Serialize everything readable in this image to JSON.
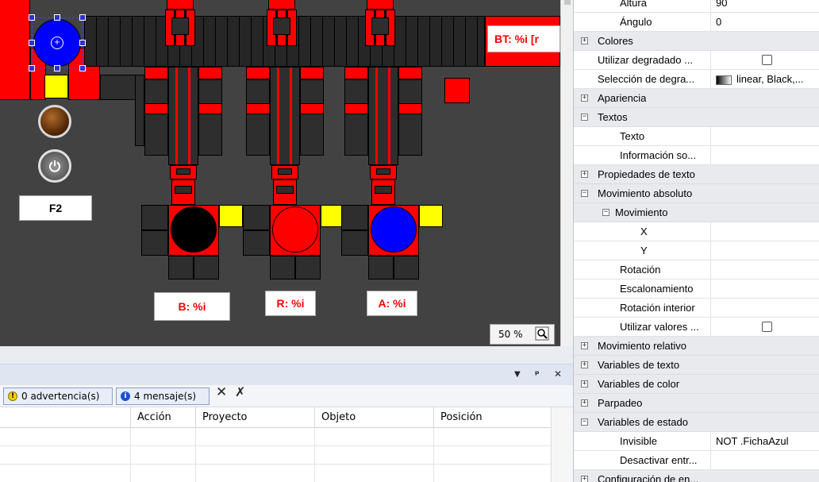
{
  "canvas": {
    "labels": {
      "bt": "BT: %i [r",
      "b": "B: %i",
      "r": "R: %i",
      "a": "A: %i",
      "f2": "F2"
    },
    "zoom": "50 %",
    "colors": {
      "background": "#424242",
      "red": "#ff0000",
      "yellow": "#ffff00",
      "blue": "#0000ff",
      "black": "#000000"
    }
  },
  "bottom_panel": {
    "header_controls": {
      "menu": "▼",
      "pin": "ᵖ",
      "close": "✕"
    },
    "filters": {
      "warnings": "0 advertencia(s)",
      "messages": "4 mensaje(s)"
    },
    "columns": [
      "Acción",
      "Proyecto",
      "Objeto",
      "Posición"
    ],
    "rows": 3
  },
  "properties": {
    "rows": [
      {
        "name": "Altura",
        "value": "90",
        "level": 2,
        "type": "prop"
      },
      {
        "name": "Ángulo",
        "value": "0",
        "level": 2,
        "type": "prop"
      },
      {
        "name": "Colores",
        "level": 0,
        "type": "cat",
        "exp": "+"
      },
      {
        "name": "Utilizar degradado ...",
        "value": "",
        "level": 1,
        "type": "check"
      },
      {
        "name": "Selección de degra...",
        "value": "linear, Black,...",
        "level": 1,
        "type": "grad"
      },
      {
        "name": "Apariencia",
        "level": 0,
        "type": "cat",
        "exp": "+"
      },
      {
        "name": "Textos",
        "level": 0,
        "type": "cat",
        "exp": "−"
      },
      {
        "name": "Texto",
        "value": "",
        "level": 2,
        "type": "prop"
      },
      {
        "name": "Información so...",
        "value": "",
        "level": 2,
        "type": "prop"
      },
      {
        "name": "Propiedades de texto",
        "level": 0,
        "type": "cat",
        "exp": "+"
      },
      {
        "name": "Movimiento absoluto",
        "level": 0,
        "type": "cat",
        "exp": "−"
      },
      {
        "name": "Movimiento",
        "level": 1,
        "type": "subcat",
        "exp": "−"
      },
      {
        "name": "X",
        "value": "",
        "level": 3,
        "type": "prop"
      },
      {
        "name": "Y",
        "value": "",
        "level": 3,
        "type": "prop"
      },
      {
        "name": "Rotación",
        "value": "",
        "level": 2,
        "type": "prop"
      },
      {
        "name": "Escalonamiento",
        "value": "",
        "level": 2,
        "type": "prop"
      },
      {
        "name": "Rotación interior",
        "value": "",
        "level": 2,
        "type": "prop"
      },
      {
        "name": "Utilizar valores ...",
        "value": "",
        "level": 2,
        "type": "check"
      },
      {
        "name": "Movimiento relativo",
        "level": 0,
        "type": "cat",
        "exp": "+"
      },
      {
        "name": "Variables de texto",
        "level": 0,
        "type": "cat",
        "exp": "+"
      },
      {
        "name": "Variables de color",
        "level": 0,
        "type": "cat",
        "exp": "+"
      },
      {
        "name": "Parpadeo",
        "level": 0,
        "type": "cat",
        "exp": "+"
      },
      {
        "name": "Variables de estado",
        "level": 0,
        "type": "cat",
        "exp": "−"
      },
      {
        "name": "Invisible",
        "value": "NOT .FichaAzul",
        "level": 2,
        "type": "prop"
      },
      {
        "name": "Desactivar entr...",
        "value": "",
        "level": 2,
        "type": "prop"
      },
      {
        "name": "Configuración de en...",
        "level": 0,
        "type": "cat",
        "exp": "+"
      }
    ]
  }
}
